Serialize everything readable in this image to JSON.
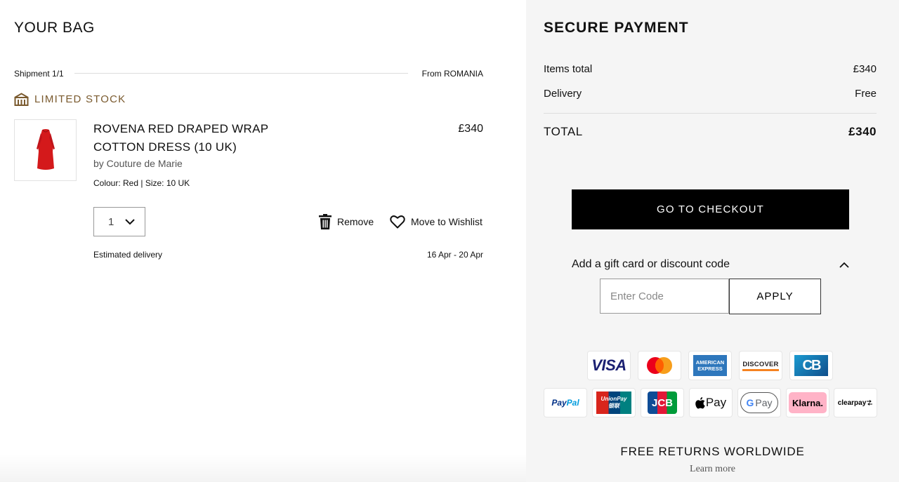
{
  "bag": {
    "title": "YOUR BAG",
    "shipment_label": "Shipment 1/1",
    "shipment_from": "From ROMANIA",
    "stock_label": "LIMITED STOCK",
    "item": {
      "name": "ROVENA RED DRAPED WRAP COTTON DRESS (10 UK)",
      "brand": "by Couture de Marie",
      "attributes": "Colour: Red | Size: 10 UK",
      "price": "£340",
      "quantity": "1",
      "remove_label": "Remove",
      "wishlist_label": "Move to Wishlist",
      "estimated_label": "Estimated delivery",
      "estimated_dates": "16 Apr - 20 Apr"
    }
  },
  "payment": {
    "title": "SECURE PAYMENT",
    "items_total_label": "Items total",
    "items_total_value": "£340",
    "delivery_label": "Delivery",
    "delivery_value": "Free",
    "total_label": "TOTAL",
    "total_value": "£340",
    "checkout_label": "GO TO CHECKOUT",
    "gift_label": "Add a gift card or discount code",
    "code_placeholder": "Enter Code",
    "apply_label": "APPLY",
    "cards": {
      "visa": "VISA",
      "amex_line1": "AMERICAN",
      "amex_line2": "EXPRESS",
      "discover": "DISCOVER",
      "cb": "CB",
      "paypal_pay": "Pay",
      "paypal_pal": "Pal",
      "unionpay": "UnionPay",
      "unionpay_cn": "银联",
      "jcb": "JCB",
      "applepay": "Pay",
      "gpay_g": "G",
      "gpay_pay": "Pay",
      "klarna": "Klarna.",
      "clearpay": "clearpay"
    },
    "returns_label": "FREE RETURNS WORLDWIDE",
    "learn_more_label": "Learn more"
  },
  "colors": {
    "stock_brown": "#7a5a2e",
    "checkout_bg": "#000000",
    "panel_bg": "#f5f5f5",
    "dress_red": "#d4191b"
  }
}
